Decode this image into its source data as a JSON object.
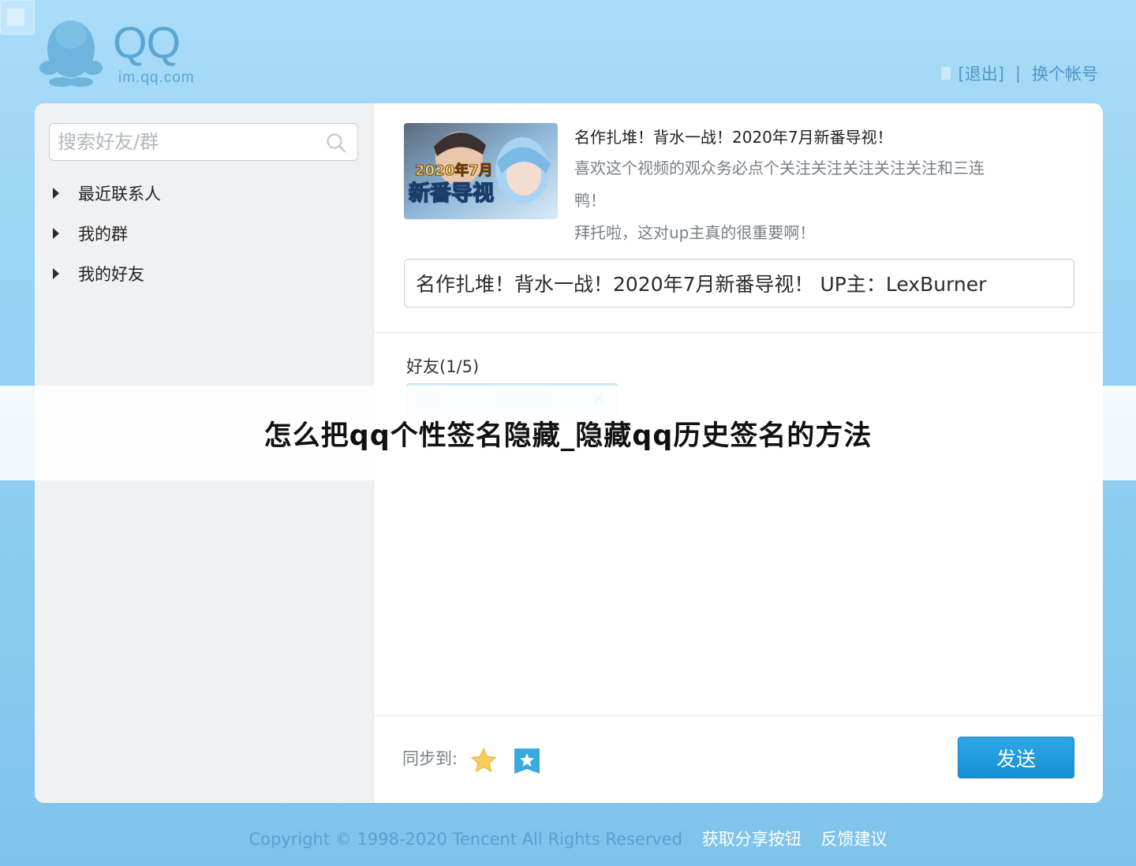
{
  "header": {
    "logo_text": "QQ",
    "logo_domain": "im.qq.com",
    "logout_link": "[退出]",
    "separator": "|",
    "switch_account_link": "换个帐号"
  },
  "sidebar": {
    "search_placeholder": "搜索好友/群",
    "groups": [
      {
        "label": "最近联系人"
      },
      {
        "label": "我的群"
      },
      {
        "label": "我的好友"
      }
    ]
  },
  "share": {
    "thumbnail_text_line1": "2020年7月",
    "thumbnail_text_line2": "新番导视",
    "title": "名作扎堆！背水一战！2020年7月新番导视！",
    "description_line1": "喜欢这个视频的观众务必点个关注关注关注关注关注和三连",
    "description_line2": "鸭！",
    "description_line3": "拜托啦，这对up主真的很重要啊！",
    "comment_text": "名作扎堆！背水一战！2020年7月新番导视！ UP主：LexBurner"
  },
  "recipients": {
    "label": "好友(1/5)",
    "chip_close": "×"
  },
  "footer_bar": {
    "sync_label": "同步到:",
    "send_label": "发送"
  },
  "footer": {
    "copyright": "Copyright © 1998-2020 Tencent All Rights Reserved",
    "link_share_button": "获取分享按钮",
    "link_feedback": "反馈建议"
  },
  "overlay": {
    "title": "怎么把qq个性签名隐藏_隐藏qq历史签名的方法"
  },
  "colors": {
    "background_top": "#a9dcf8",
    "background_bottom": "#7fc3ec",
    "send_button": "#1e9ad9",
    "link_blue": "#4e94c7"
  }
}
